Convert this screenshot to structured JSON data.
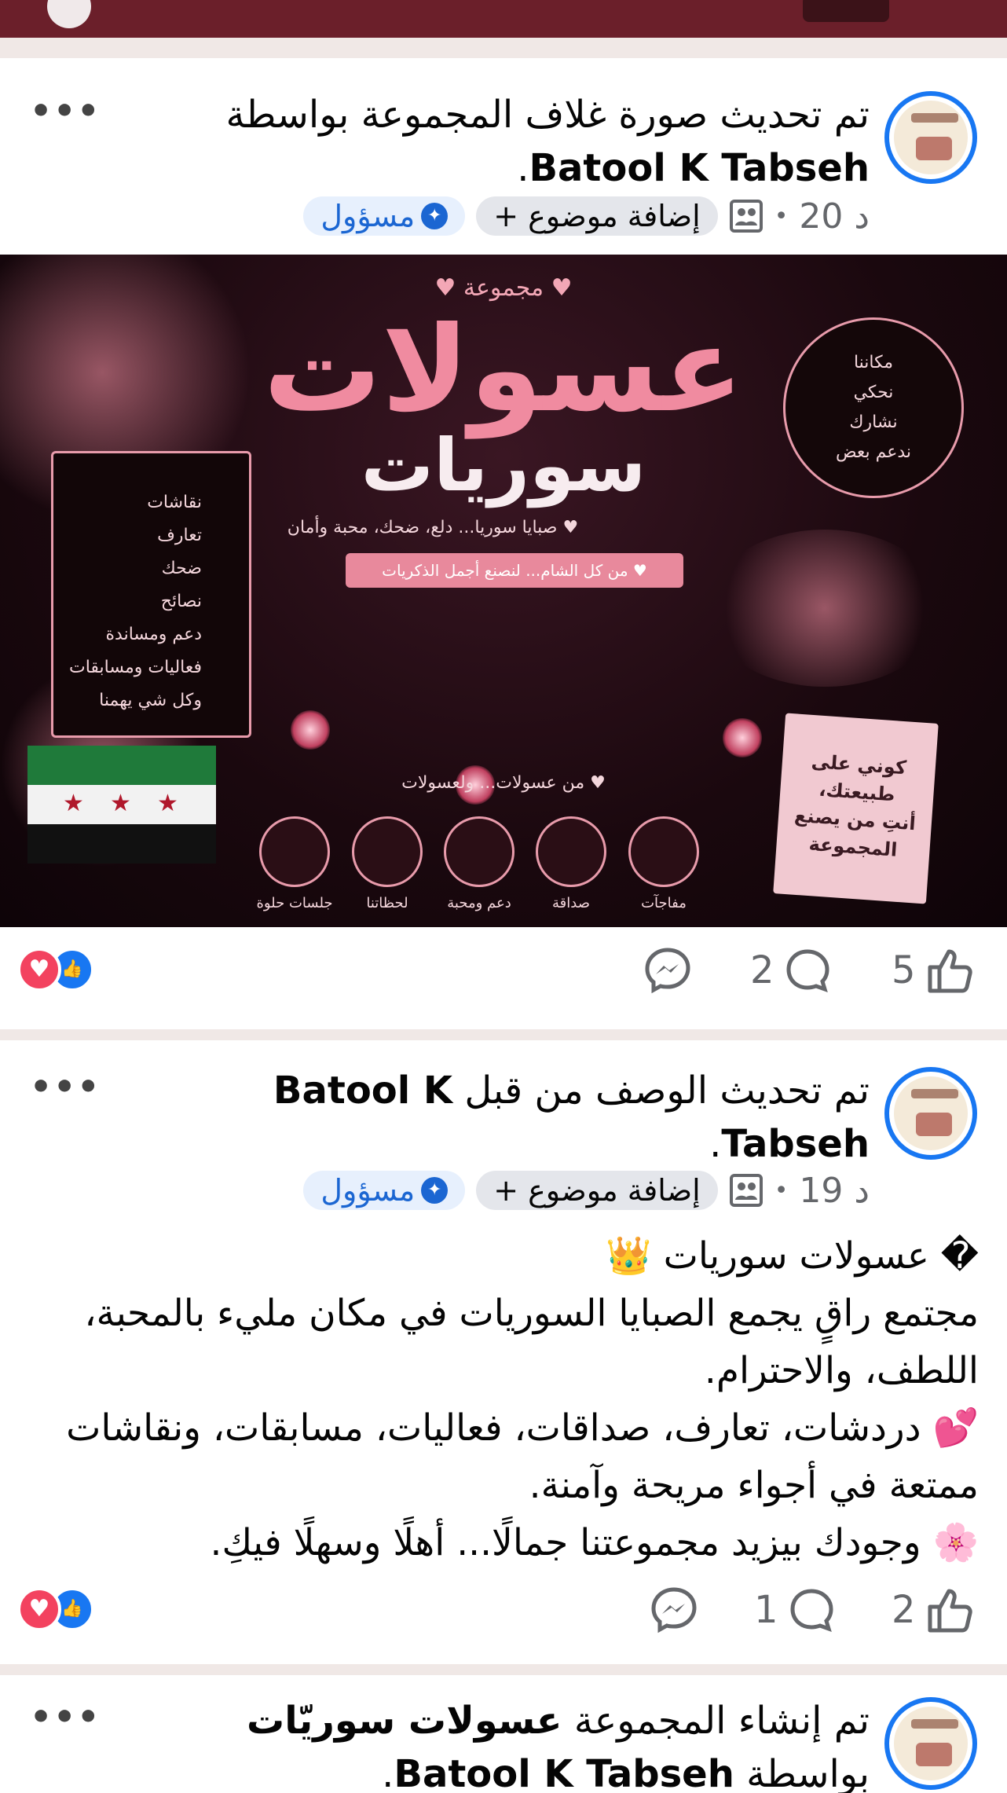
{
  "posts": [
    {
      "title_prefix": "تم تحديث صورة غلاف المجموعة بواسطة",
      "author": "Batool K Tabseh",
      "title_suffix": ".",
      "time": "20 د",
      "add_topic": "إضافة موضوع +",
      "role": "مسؤول",
      "more": "•••",
      "likes": "5",
      "comments": "2"
    },
    {
      "title_prefix": "تم تحديث الوصف من قبل",
      "author": "Batool K Tabseh",
      "title_suffix": ".",
      "time": "19 د",
      "add_topic": "إضافة موضوع +",
      "role": "مسؤول",
      "more": "•••",
      "body_lines": [
        "� عسولات سوريات 👑",
        "مجتمع راقٍ يجمع الصبايا السوريات في مكان مليء بالمحبة، اللطف، والاحترام.",
        "💕 دردشات، تعارف، صداقات، فعاليات، مسابقات، ونقاشات ممتعة في أجواء مريحة وآمنة.",
        "🌸 وجودك بيزيد مجموعتنا جمالًا... أهلًا وسهلًا فيكِ."
      ],
      "likes": "2",
      "comments": "1"
    },
    {
      "title_prefix": "تم إنشاء المجموعة",
      "group_name": "عسولات سوريّات",
      "title_mid": "بواسطة",
      "author": "Batool K Tabseh",
      "title_suffix": ".",
      "more": "•••"
    }
  ],
  "cover": {
    "small_top": "♥ مجموعة ♥",
    "name_line1": "عسولات",
    "name_line2": "سوريات",
    "tagline": "♥ صبايا سوريا... دلع، ضحك، محبة وأمان",
    "banner": "♥ من كل الشام... لنصنع أجمل الذكريات",
    "left_list": [
      "نقاشات",
      "تعارف",
      "ضحك",
      "نصائح",
      "دعم ومساندة",
      "فعاليات ومسابقات",
      "وكل شي يهمنا"
    ],
    "right_circle": [
      "مكاننا",
      "نحكي",
      "نشارك",
      "ندعم بعض"
    ],
    "bottom_line": "♥ من عسولات... ولعسولات",
    "icon_labels": [
      "مفاجآت",
      "صداقة",
      "دعم ومحبة",
      "لحظاتنا",
      "جلسات حلوة"
    ],
    "note_lines": [
      "كوني على",
      "طبيعتك،",
      "أنتِ من يصنع",
      "المجموعة"
    ]
  },
  "colors": {
    "header": "#6b1f2a",
    "link_blue": "#1877f2",
    "admin_blue": "#1b66d2",
    "love": "#f3425f"
  }
}
